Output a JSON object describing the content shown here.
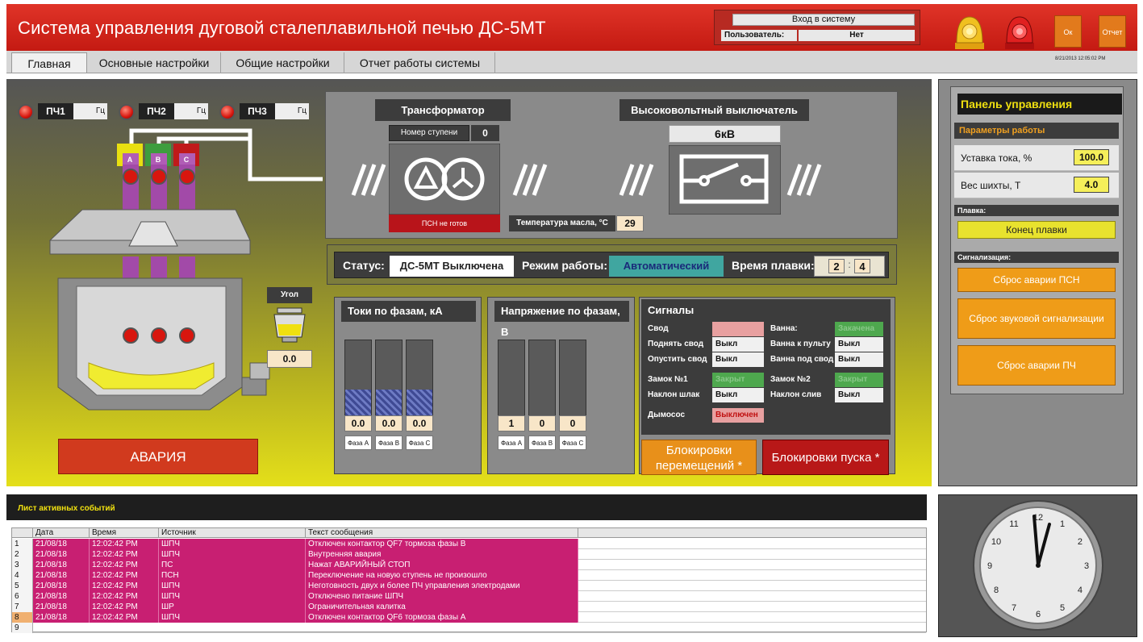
{
  "header": {
    "title": "Система управления дуговой сталеплавильной печью ДС-5МТ",
    "login_button": "Вход в систему",
    "user_label": "Пользователь:",
    "user_value": "Нет",
    "ok_label": "Ок",
    "report_label": "Отчет"
  },
  "tabs": [
    {
      "label": "Главная",
      "active": true
    },
    {
      "label": "Основные настройки"
    },
    {
      "label": "Общие настройки"
    },
    {
      "label": "Отчет работы системы"
    }
  ],
  "datetime": "8/21/2013 12:05:02 PM",
  "furnace": {
    "pch": [
      {
        "label": "ПЧ1",
        "unit": "Гц"
      },
      {
        "label": "ПЧ2",
        "unit": "Гц"
      },
      {
        "label": "ПЧ3",
        "unit": "Гц"
      }
    ],
    "electrodes": [
      "A",
      "B",
      "C"
    ],
    "angle_label": "Угол",
    "angle_value": "0.0",
    "alarm_label": "АВАРИЯ"
  },
  "transformer": {
    "title": "Трансформатор",
    "step_label": "Номер ступени",
    "step_value": "0",
    "psn_status": "ПСН не готов",
    "oil_temp_label": "Температура масла, °C",
    "oil_temp_value": "29"
  },
  "breaker": {
    "title": "Высоковольтный выключатель",
    "voltage": "6кВ"
  },
  "status": {
    "status_label": "Статус:",
    "status_value": "ДС-5МТ Выключена",
    "mode_label": "Режим работы:",
    "mode_value": "Автоматический",
    "time_label": "Время плавки:",
    "time_h": "2",
    "time_sep": ":",
    "time_m": "4"
  },
  "currents": {
    "title": "Токи по фазам, кА",
    "values": [
      "0.0",
      "0.0",
      "0.0"
    ],
    "fill": [
      0.45,
      0.45,
      0.45
    ],
    "phases": [
      "Фаза А",
      "Фаза В",
      "Фаза С"
    ]
  },
  "voltages": {
    "title": "Напряжение по фазам, В",
    "values": [
      "1",
      "0",
      "0"
    ],
    "phases": [
      "Фаза А",
      "Фаза В",
      "Фаза С"
    ]
  },
  "signals": {
    "title": "Сигналы",
    "rows": [
      [
        {
          "label": "Свод",
          "value": "",
          "kind": "p"
        },
        {
          "label": "Ванна:",
          "value": "Закачена",
          "kind": "g"
        }
      ],
      [
        {
          "label": "Поднять свод",
          "value": "Выкл"
        },
        {
          "label": "Ванна к пульту",
          "value": "Выкл"
        }
      ],
      [
        {
          "label": "Опустить свод",
          "value": "Выкл"
        },
        {
          "label": "Ванна под свод",
          "value": "Выкл"
        }
      ],
      [
        {
          "label": "Замок №1",
          "value": "Закрыт",
          "kind": "g"
        },
        {
          "label": "Замок №2",
          "value": "Закрыт",
          "kind": "g"
        }
      ],
      [
        {
          "label": "Наклон шлак",
          "value": "Выкл"
        },
        {
          "label": "Наклон слив",
          "value": "Выкл"
        }
      ],
      [
        {
          "label": "Дымосос",
          "value": "Выключен",
          "kind": "r"
        }
      ]
    ],
    "block_move": "Блокировки перемещений *",
    "block_start": "Блокировки пуска *"
  },
  "control": {
    "title": "Панель управления",
    "params_title": "Параметры работы",
    "current_setpoint_label": "Уставка тока, %",
    "current_setpoint_value": "100.0",
    "charge_weight_label": "Вес шихты, Т",
    "charge_weight_value": "4.0",
    "melt_label": "Плавка:",
    "end_melt": "Конец плавки",
    "alarm_sig_label": "Сигнализация:",
    "reset_psn": "Сброс аварии ПСН",
    "reset_sound": "Сброс звуковой сигнализации",
    "reset_pch": "Сброс аварии ПЧ"
  },
  "events": {
    "title": "Лист активных событий",
    "columns": [
      "Дата",
      "Время",
      "Источник",
      "Текст сообщения"
    ],
    "rows": [
      {
        "n": "1",
        "date": "21/08/18",
        "time": "12:02:42 PM",
        "src": "ШПЧ",
        "text": "Отключен контактор QF7 тормоза фазы В"
      },
      {
        "n": "2",
        "date": "21/08/18",
        "time": "12:02:42 PM",
        "src": "ШПЧ",
        "text": "Внутренняя авария"
      },
      {
        "n": "3",
        "date": "21/08/18",
        "time": "12:02:42 PM",
        "src": "ПС",
        "text": "Нажат АВАРИЙНЫЙ СТОП"
      },
      {
        "n": "4",
        "date": "21/08/18",
        "time": "12:02:42 PM",
        "src": "ПСН",
        "text": "Переключение на новую ступень не произошло"
      },
      {
        "n": "5",
        "date": "21/08/18",
        "time": "12:02:42 PM",
        "src": "ШПЧ",
        "text": "Неготовность двух и более ПЧ управления электродами"
      },
      {
        "n": "6",
        "date": "21/08/18",
        "time": "12:02:42 PM",
        "src": "ШПЧ",
        "text": "Отключено питание ШПЧ"
      },
      {
        "n": "7",
        "date": "21/08/18",
        "time": "12:02:42 PM",
        "src": "ШР",
        "text": "Ограничительная калитка"
      },
      {
        "n": "8",
        "date": "21/08/18",
        "time": "12:02:42 PM",
        "src": "ШПЧ",
        "text": "Отключен контактор QF6 тормоза фазы А"
      },
      {
        "n": "9",
        "date": "",
        "time": "",
        "src": "",
        "text": ""
      }
    ]
  },
  "clock": {
    "numbers": [
      "12",
      "1",
      "2",
      "3",
      "4",
      "5",
      "6",
      "7",
      "8",
      "9",
      "10",
      "11"
    ]
  },
  "colors": {
    "header_red": "#c41a12",
    "accent_orange": "#ef9c18",
    "event_row": "#c81f72",
    "mode_teal": "#40a6a0"
  }
}
